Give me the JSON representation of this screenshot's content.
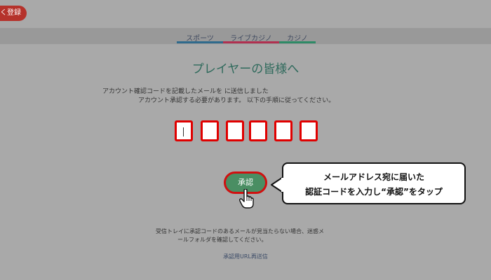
{
  "header": {
    "register_button": "く登録"
  },
  "tabs": [
    {
      "label": "スポーツ",
      "color": "#2f6a8c"
    },
    {
      "label": "ライブカジノ",
      "color": "#b03050"
    },
    {
      "label": "カジノ",
      "color": "#2e8a66"
    }
  ],
  "main": {
    "title": "プレイヤーの皆様へ",
    "instruction_line1": "アカウント確認コードを記載したメールを に送信しました",
    "instruction_line2": "アカウント承認する必要があります。 以下の手順に従ってください。",
    "code_boxes": [
      "",
      "",
      "",
      "",
      "",
      ""
    ],
    "approve_button": "承認",
    "help_line1": "受信トレイに承認コードのあるメールが見当たらない場合、迷惑メ",
    "help_line2": "ールフォルダを確認してください。",
    "resend_link": "承認用URL再送信"
  },
  "callout": {
    "line1": "メールアドレス宛に届いた",
    "line2": "認証コードを入力し“承認”をタップ"
  },
  "colors": {
    "accent_red": "#e00000",
    "button_green": "#4a8e63",
    "title_green": "#2f6a5c"
  }
}
